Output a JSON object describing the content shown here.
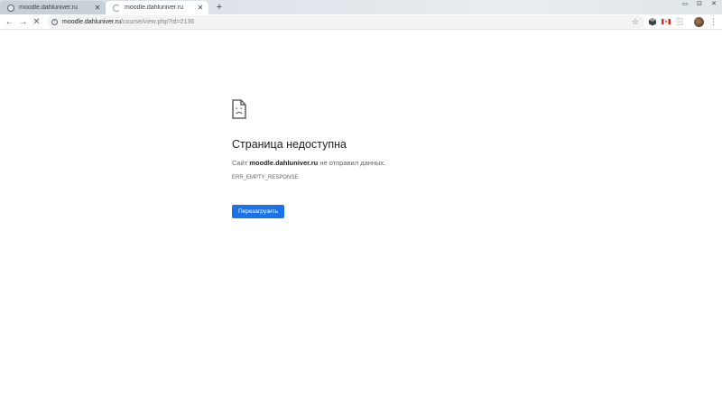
{
  "browser": {
    "tabs": [
      {
        "title": "moodle.dahluniver.ru",
        "close": "✕"
      },
      {
        "title": "moodle.dahluniver.ru",
        "close": "✕"
      }
    ],
    "new_tab": "+",
    "window_controls": [
      "▭",
      "⊡",
      "✕"
    ],
    "nav": {
      "back": "←",
      "forward": "→",
      "stop": "✕"
    },
    "address": {
      "host": "moodle.dahluniver.ru",
      "path": "/course/view.php?id=2136"
    },
    "bookmark_star": "☆",
    "menu": "⋮"
  },
  "error_page": {
    "title": "Страница недоступна",
    "desc_prefix": "Сайт ",
    "desc_host": "moodle.dahluniver.ru",
    "desc_suffix": " не отправил данных.",
    "code": "ERR_EMPTY_RESPONSE",
    "reload_label": "Перезагрузить"
  },
  "colors": {
    "accent": "#1a73e8"
  }
}
